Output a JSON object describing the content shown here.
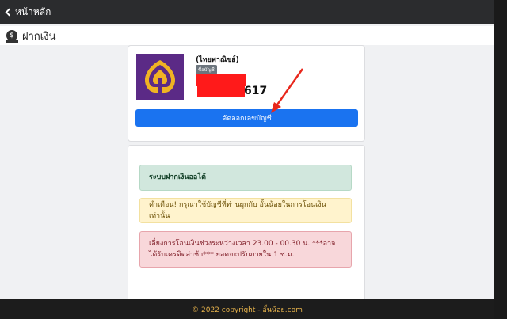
{
  "topbar": {
    "back_label": "หน้าหลัก"
  },
  "section": {
    "title": "ฝากเงิน",
    "icon": "deposit-icon"
  },
  "bank": {
    "name": "(ไทยพาณิชย์)",
    "badge": "ชื่อบัญชี",
    "account_tail": "617",
    "logo_colors": {
      "background": "#5b2a86",
      "emblem": "#f0b323"
    }
  },
  "copy_button": {
    "label": "คัดลอกเลขบัญชี",
    "color": "#1a73f0"
  },
  "alerts": {
    "success": "ระบบฝากเงินออโต้",
    "warning": "คำเตือน! กรุณาใช้บัญชีที่ท่านผูกกับ อั้นน้อยในการโอนเงินเท่านั้น",
    "danger": "เลี่ยงการโอนเงินช่วงระหว่างเวลา 23.00 - 00.30 น. ***อาจได้รับเครดิตล่าช้า*** ยอดจะปรับภายใน 1 ช.ม."
  },
  "footer": {
    "text": "© 2022 copyright - อั้นน้อย.com"
  },
  "annotation": {
    "color": "#e8271c"
  }
}
